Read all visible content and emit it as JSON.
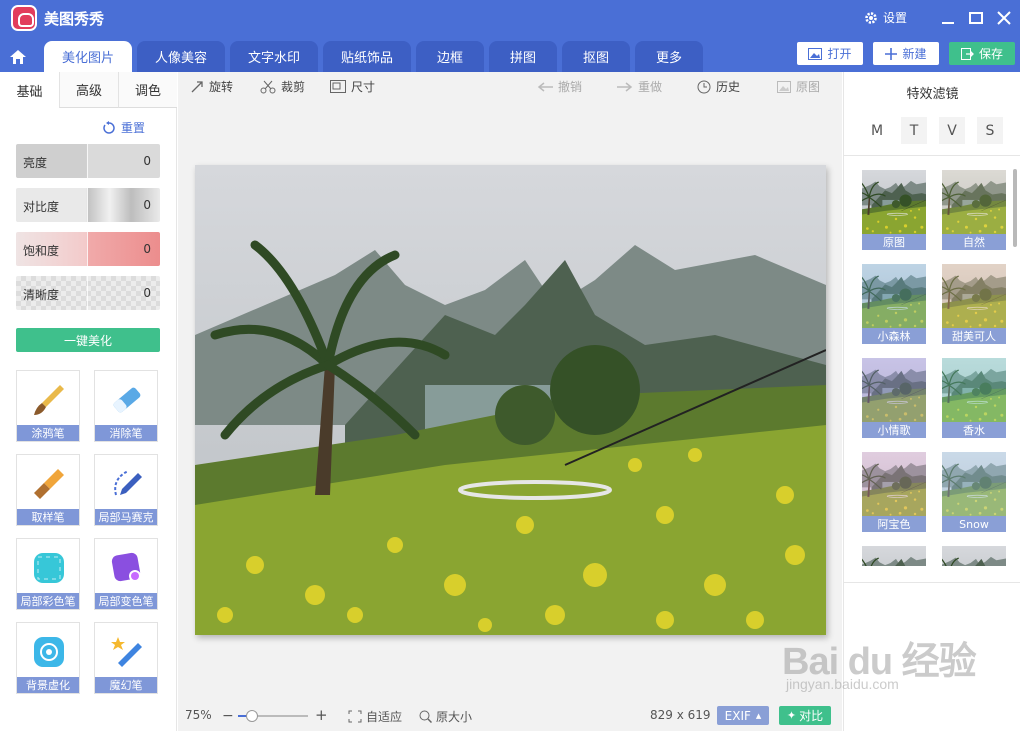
{
  "app": {
    "title": "美图秀秀",
    "settings_label": "设置"
  },
  "tabs": [
    {
      "label": "美化图片"
    },
    {
      "label": "人像美容"
    },
    {
      "label": "文字水印"
    },
    {
      "label": "贴纸饰品"
    },
    {
      "label": "边框"
    },
    {
      "label": "拼图"
    },
    {
      "label": "抠图"
    },
    {
      "label": "更多"
    }
  ],
  "top_actions": {
    "open": "打开",
    "new": "新建",
    "save": "保存"
  },
  "left_panel": {
    "subtabs": [
      {
        "label": "基础"
      },
      {
        "label": "高级"
      },
      {
        "label": "调色"
      }
    ],
    "reset_label": "重置",
    "sliders": [
      {
        "label": "亮度",
        "value": "0"
      },
      {
        "label": "对比度",
        "value": "0"
      },
      {
        "label": "饱和度",
        "value": "0"
      },
      {
        "label": "清晰度",
        "value": "0"
      }
    ],
    "onekey_label": "一键美化",
    "tools": [
      {
        "label": "涂鸦笔",
        "icon": "paintbrush-icon"
      },
      {
        "label": "消除笔",
        "icon": "eraser-icon"
      },
      {
        "label": "取样笔",
        "icon": "sample-brush-icon"
      },
      {
        "label": "局部马赛克",
        "icon": "mosaic-pen-icon"
      },
      {
        "label": "局部彩色笔",
        "icon": "color-pen-icon"
      },
      {
        "label": "局部变色笔",
        "icon": "recolor-pen-icon"
      },
      {
        "label": "背景虚化",
        "icon": "blur-background-icon"
      },
      {
        "label": "魔幻笔",
        "icon": "magic-pen-icon"
      }
    ]
  },
  "toolbar": {
    "rotate": "旋转",
    "crop": "裁剪",
    "size": "尺寸",
    "undo": "撤销",
    "redo": "重做",
    "history": "历史",
    "original": "原图"
  },
  "status": {
    "zoom": "75%",
    "zoom_level": 0.2,
    "fit": "自适应",
    "actual": "原大小",
    "dimensions": "829 x 619",
    "exif": "EXIF",
    "compare": "对比"
  },
  "right_panel": {
    "title": "特效滤镜",
    "categories": [
      "M",
      "T",
      "V",
      "S"
    ],
    "filters": [
      {
        "label": "原图",
        "tint": "rgba(0,0,0,0)"
      },
      {
        "label": "自然",
        "tint": "rgba(255,230,170,0.15)"
      },
      {
        "label": "小森林",
        "tint": "rgba(120,200,255,0.25)"
      },
      {
        "label": "甜美可人",
        "tint": "rgba(255,200,150,0.30)"
      },
      {
        "label": "小情歌",
        "tint": "rgba(170,150,255,0.30)"
      },
      {
        "label": "香水",
        "tint": "rgba(120,230,220,0.30)"
      },
      {
        "label": "阿宝色",
        "tint": "rgba(255,170,230,0.25)"
      },
      {
        "label": "Snow",
        "tint": "rgba(180,220,255,0.35)"
      }
    ]
  },
  "watermark": {
    "main": "Bai du 经验",
    "sub": "jingyan.baidu.com"
  },
  "colors": {
    "accent": "#4a6fd6",
    "green": "#3fc08c",
    "label_bg": "#8a9fd6"
  }
}
